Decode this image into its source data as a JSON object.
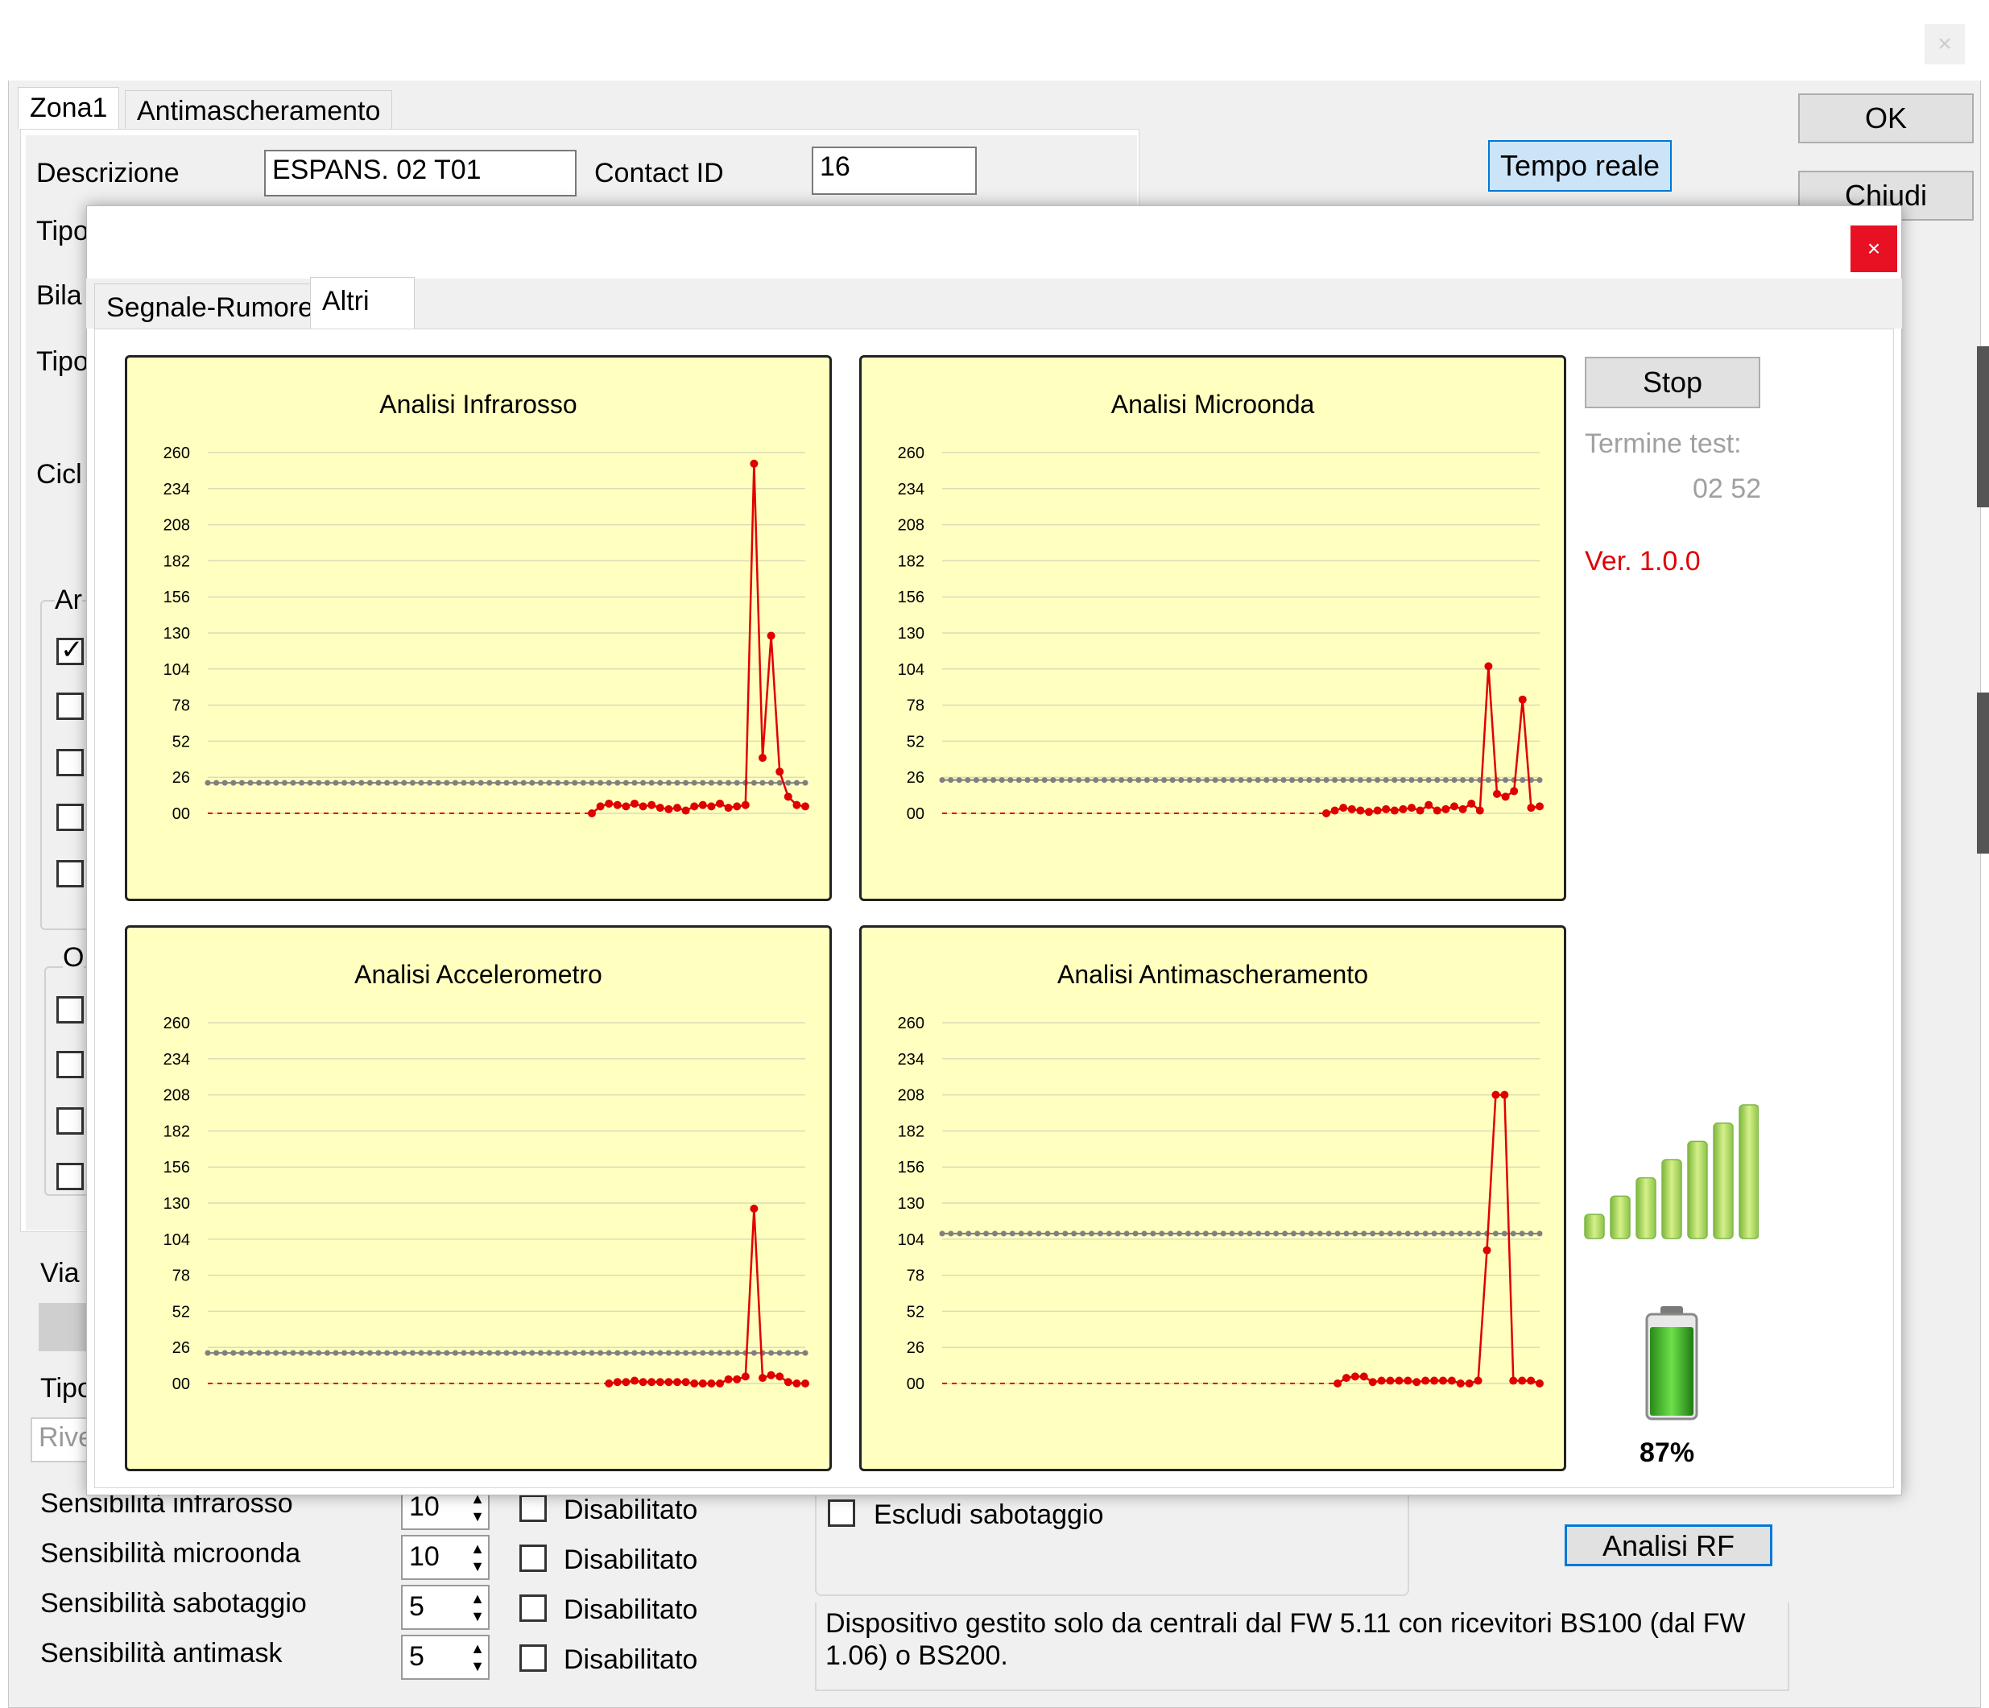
{
  "main_window": {
    "tabs": [
      "Zona1",
      "Antimascheramento"
    ],
    "ok_label": "OK",
    "close_label": "Chiudi",
    "realtime_label": "Tempo reale",
    "description_label": "Descrizione",
    "description_value": "ESPANS. 02 T01",
    "contact_id_label": "Contact ID",
    "contact_id_value": "16",
    "partial_labels": [
      "Tipo",
      "Bila",
      "Tipo",
      "Cicl",
      "Ar",
      "O",
      "Via",
      "Tipo"
    ],
    "dropdown_partial": "Rive",
    "sensitivities": [
      {
        "label": "Sensibilità infrarosso",
        "value": "10",
        "disabled_label": "Disabilitato"
      },
      {
        "label": "Sensibilità microonda",
        "value": "10",
        "disabled_label": "Disabilitato"
      },
      {
        "label": "Sensibilità sabotaggio",
        "value": "5",
        "disabled_label": "Disabilitato"
      },
      {
        "label": "Sensibilità antimask",
        "value": "5",
        "disabled_label": "Disabilitato"
      }
    ],
    "exclude_tamper_label": "Escludi sabotaggio",
    "rf_analysis_label": "Analisi RF",
    "note": "Dispositivo gestito solo da centrali dal FW 5.11 con ricevitori BS100 (dal FW 1.06) o BS200."
  },
  "popup": {
    "close_label": "×",
    "tabs": [
      "Segnale-Rumore",
      "Altri"
    ],
    "stop_label": "Stop",
    "end_test_label": "Termine test:",
    "end_test_value": "02 52",
    "version": "Ver. 1.0.0",
    "signal_level_bars": 7,
    "battery_percent": "87%",
    "colors": {
      "chart_bg": "#ffffc0",
      "series": "#e00000",
      "threshold": "#808080",
      "version": "#e00000"
    }
  },
  "chart_data": [
    {
      "type": "line",
      "title": "Analisi Infrarosso",
      "yticks": [
        "260",
        "234",
        "208",
        "182",
        "156",
        "130",
        "104",
        "78",
        "52",
        "26",
        "00"
      ],
      "ylim": [
        0,
        260
      ],
      "threshold": 22,
      "series": [
        {
          "values": [
            0,
            0,
            0,
            0,
            0,
            0,
            0,
            0,
            0,
            0,
            0,
            0,
            0,
            0,
            0,
            0,
            0,
            0,
            0,
            0,
            0,
            0,
            0,
            0,
            0,
            0,
            0,
            0,
            0,
            0,
            0,
            0,
            0,
            0,
            0,
            0,
            0,
            0,
            0,
            0,
            0,
            0,
            0,
            0,
            0,
            0,
            5,
            7,
            6,
            5,
            7,
            5,
            6,
            4,
            3,
            4,
            2,
            5,
            6,
            5,
            7,
            4,
            5,
            6,
            252,
            40,
            128,
            30,
            12,
            6,
            5
          ]
        }
      ]
    },
    {
      "type": "line",
      "title": "Analisi Microonda",
      "yticks": [
        "260",
        "234",
        "208",
        "182",
        "156",
        "130",
        "104",
        "78",
        "52",
        "26",
        "00"
      ],
      "ylim": [
        0,
        260
      ],
      "threshold": 24,
      "series": [
        {
          "values": [
            0,
            0,
            0,
            0,
            0,
            0,
            0,
            0,
            0,
            0,
            0,
            0,
            0,
            0,
            0,
            0,
            0,
            0,
            0,
            0,
            0,
            0,
            0,
            0,
            0,
            0,
            0,
            0,
            0,
            0,
            0,
            0,
            0,
            0,
            0,
            0,
            0,
            0,
            0,
            0,
            0,
            0,
            0,
            0,
            0,
            0,
            2,
            4,
            3,
            2,
            1,
            2,
            3,
            2,
            3,
            4,
            2,
            6,
            2,
            3,
            5,
            3,
            7,
            2,
            106,
            14,
            12,
            16,
            82,
            4,
            5
          ]
        }
      ]
    },
    {
      "type": "line",
      "title": "Analisi Accelerometro",
      "yticks": [
        "260",
        "234",
        "208",
        "182",
        "156",
        "130",
        "104",
        "78",
        "52",
        "26",
        "00"
      ],
      "ylim": [
        0,
        260
      ],
      "threshold": 22,
      "series": [
        {
          "values": [
            0,
            0,
            0,
            0,
            0,
            0,
            0,
            0,
            0,
            0,
            0,
            0,
            0,
            0,
            0,
            0,
            0,
            0,
            0,
            0,
            0,
            0,
            0,
            0,
            0,
            0,
            0,
            0,
            0,
            0,
            0,
            0,
            0,
            0,
            0,
            0,
            0,
            0,
            0,
            0,
            0,
            0,
            0,
            0,
            0,
            0,
            0,
            0,
            1,
            1,
            2,
            1,
            1,
            1,
            1,
            1,
            1,
            0,
            0,
            0,
            0,
            3,
            3,
            5,
            126,
            4,
            6,
            5,
            1,
            0,
            0
          ]
        }
      ]
    },
    {
      "type": "line",
      "title": "Analisi Antimascheramento",
      "yticks": [
        "260",
        "234",
        "208",
        "182",
        "156",
        "130",
        "104",
        "78",
        "52",
        "26",
        "00"
      ],
      "ylim": [
        0,
        260
      ],
      "threshold": 108,
      "series": [
        {
          "values": [
            0,
            0,
            0,
            0,
            0,
            0,
            0,
            0,
            0,
            0,
            0,
            0,
            0,
            0,
            0,
            0,
            0,
            0,
            0,
            0,
            0,
            0,
            0,
            0,
            0,
            0,
            0,
            0,
            0,
            0,
            0,
            0,
            0,
            0,
            0,
            0,
            0,
            0,
            0,
            0,
            0,
            0,
            0,
            0,
            0,
            0,
            4,
            5,
            5,
            1,
            2,
            2,
            2,
            2,
            1,
            2,
            2,
            2,
            2,
            0,
            0,
            2,
            96,
            208,
            208,
            2,
            2,
            2,
            0
          ]
        }
      ]
    }
  ]
}
